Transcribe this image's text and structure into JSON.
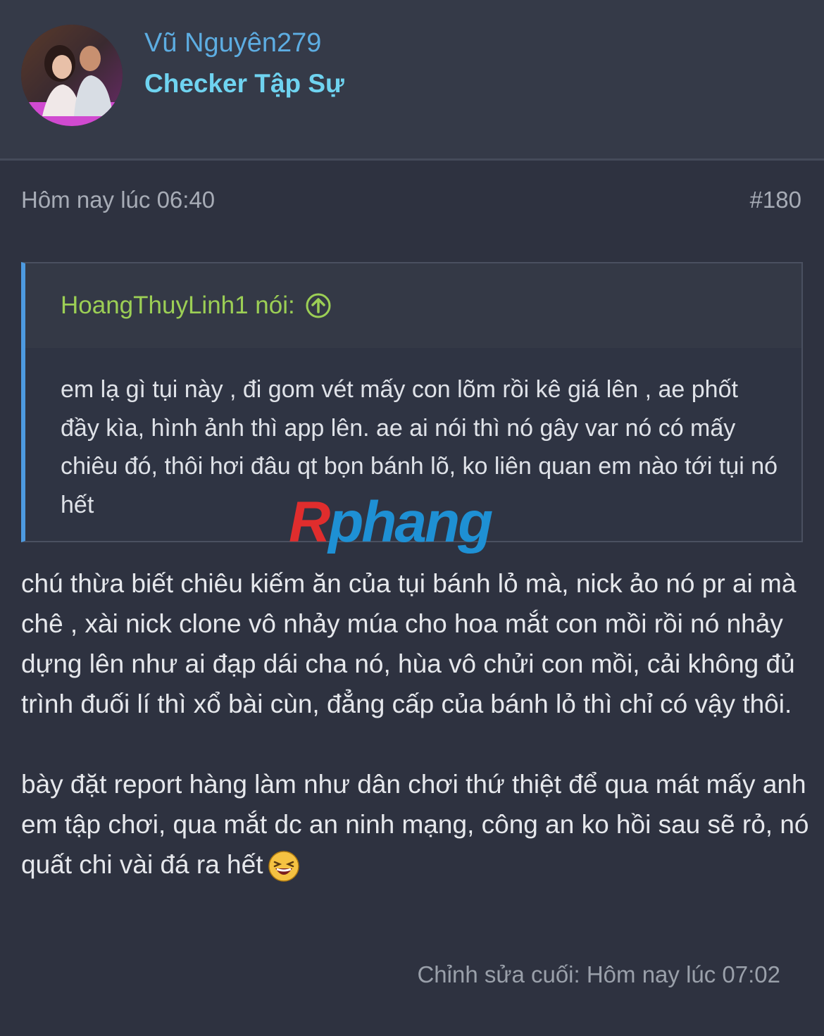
{
  "user": {
    "name": "Vũ Nguyên279",
    "title": "Checker Tập Sự",
    "avatar_icon": "user-avatar-photo"
  },
  "post": {
    "time": "Hôm nay lúc 06:40",
    "number": "#180",
    "quote": {
      "author": "HoangThuyLinh1 nói:",
      "icon": "arrow-up-circle-icon",
      "text": "em lạ gì tụi này , đi gom vét mấy con lõm rồi kê giá lên , ae phốt đầy kìa, hình ảnh thì app lên. ae ai nói thì nó gây var nó có mấy chiêu đó, thôi hơi đâu qt bọn bánh lõ, ko liên quan em nào tới tụi nó hết"
    },
    "paragraph1": "chú thừa biết chiêu kiếm ăn của tụi bánh lỏ mà, nick ảo nó pr ai mà chê , xài nick clone vô nhảy múa cho hoa mắt con mồi rồi nó nhảy dựng lên như ai đạp dái cha nó, hùa vô chửi con mồi, cải không đủ trình đuối lí thì xổ bài cùn, đẳng cấp của bánh lỏ thì chỉ có vậy thôi.",
    "paragraph2": "bày đặt report hàng làm như dân chơi thứ thiệt để qua mát mấy anh em tập chơi, qua mắt dc an ninh mạng, công an ko hồi sau sẽ rỏ, nó quất chi vài đá ra hết",
    "emoji": "laughing-emoji-icon",
    "edited": "Chỉnh sửa cuối: Hôm nay lúc 07:02"
  },
  "watermark": {
    "part1": "R",
    "part2": "phang"
  },
  "colors": {
    "background": "#2e3240",
    "username": "#5dade2",
    "usertitle": "#6fd3f0",
    "quote_author": "#9ccf55",
    "quote_border": "#4d9ae0"
  }
}
